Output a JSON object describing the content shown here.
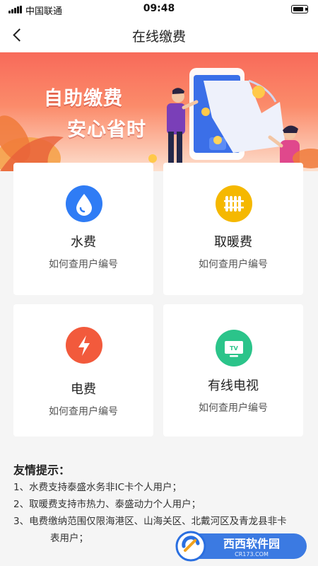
{
  "status_bar": {
    "carrier": "中国联通",
    "time": "09:48",
    "battery_level": 0.85
  },
  "nav": {
    "title": "在线缴费"
  },
  "banner": {
    "line1": "自助缴费",
    "line2": "安心省时"
  },
  "services": [
    {
      "title": "水费",
      "subtitle": "如何查用户编号",
      "icon": "water-drop-icon",
      "color": "#2f7cf5"
    },
    {
      "title": "取暖费",
      "subtitle": "如何查用户编号",
      "icon": "radiator-icon",
      "color": "#f5b800"
    },
    {
      "title": "电费",
      "subtitle": "如何查用户编号",
      "icon": "lightning-icon",
      "color": "#f25a3c"
    },
    {
      "title": "有线电视",
      "subtitle": "如何查用户编号",
      "icon": "tv-icon",
      "color": "#2bc48a"
    }
  ],
  "tips": {
    "heading": "友情提示：",
    "items": [
      "1、水费支持泰盛水务非IC卡个人用户；",
      "2、取暖费支持市热力、泰盛动力个人用户；",
      "3、电费缴纳范围仅限海港区、山海关区、北戴河区及青龙县非卡",
      "表用户；"
    ]
  },
  "watermark": {
    "brand": "西西软件园",
    "domain": "CR173.COM"
  }
}
